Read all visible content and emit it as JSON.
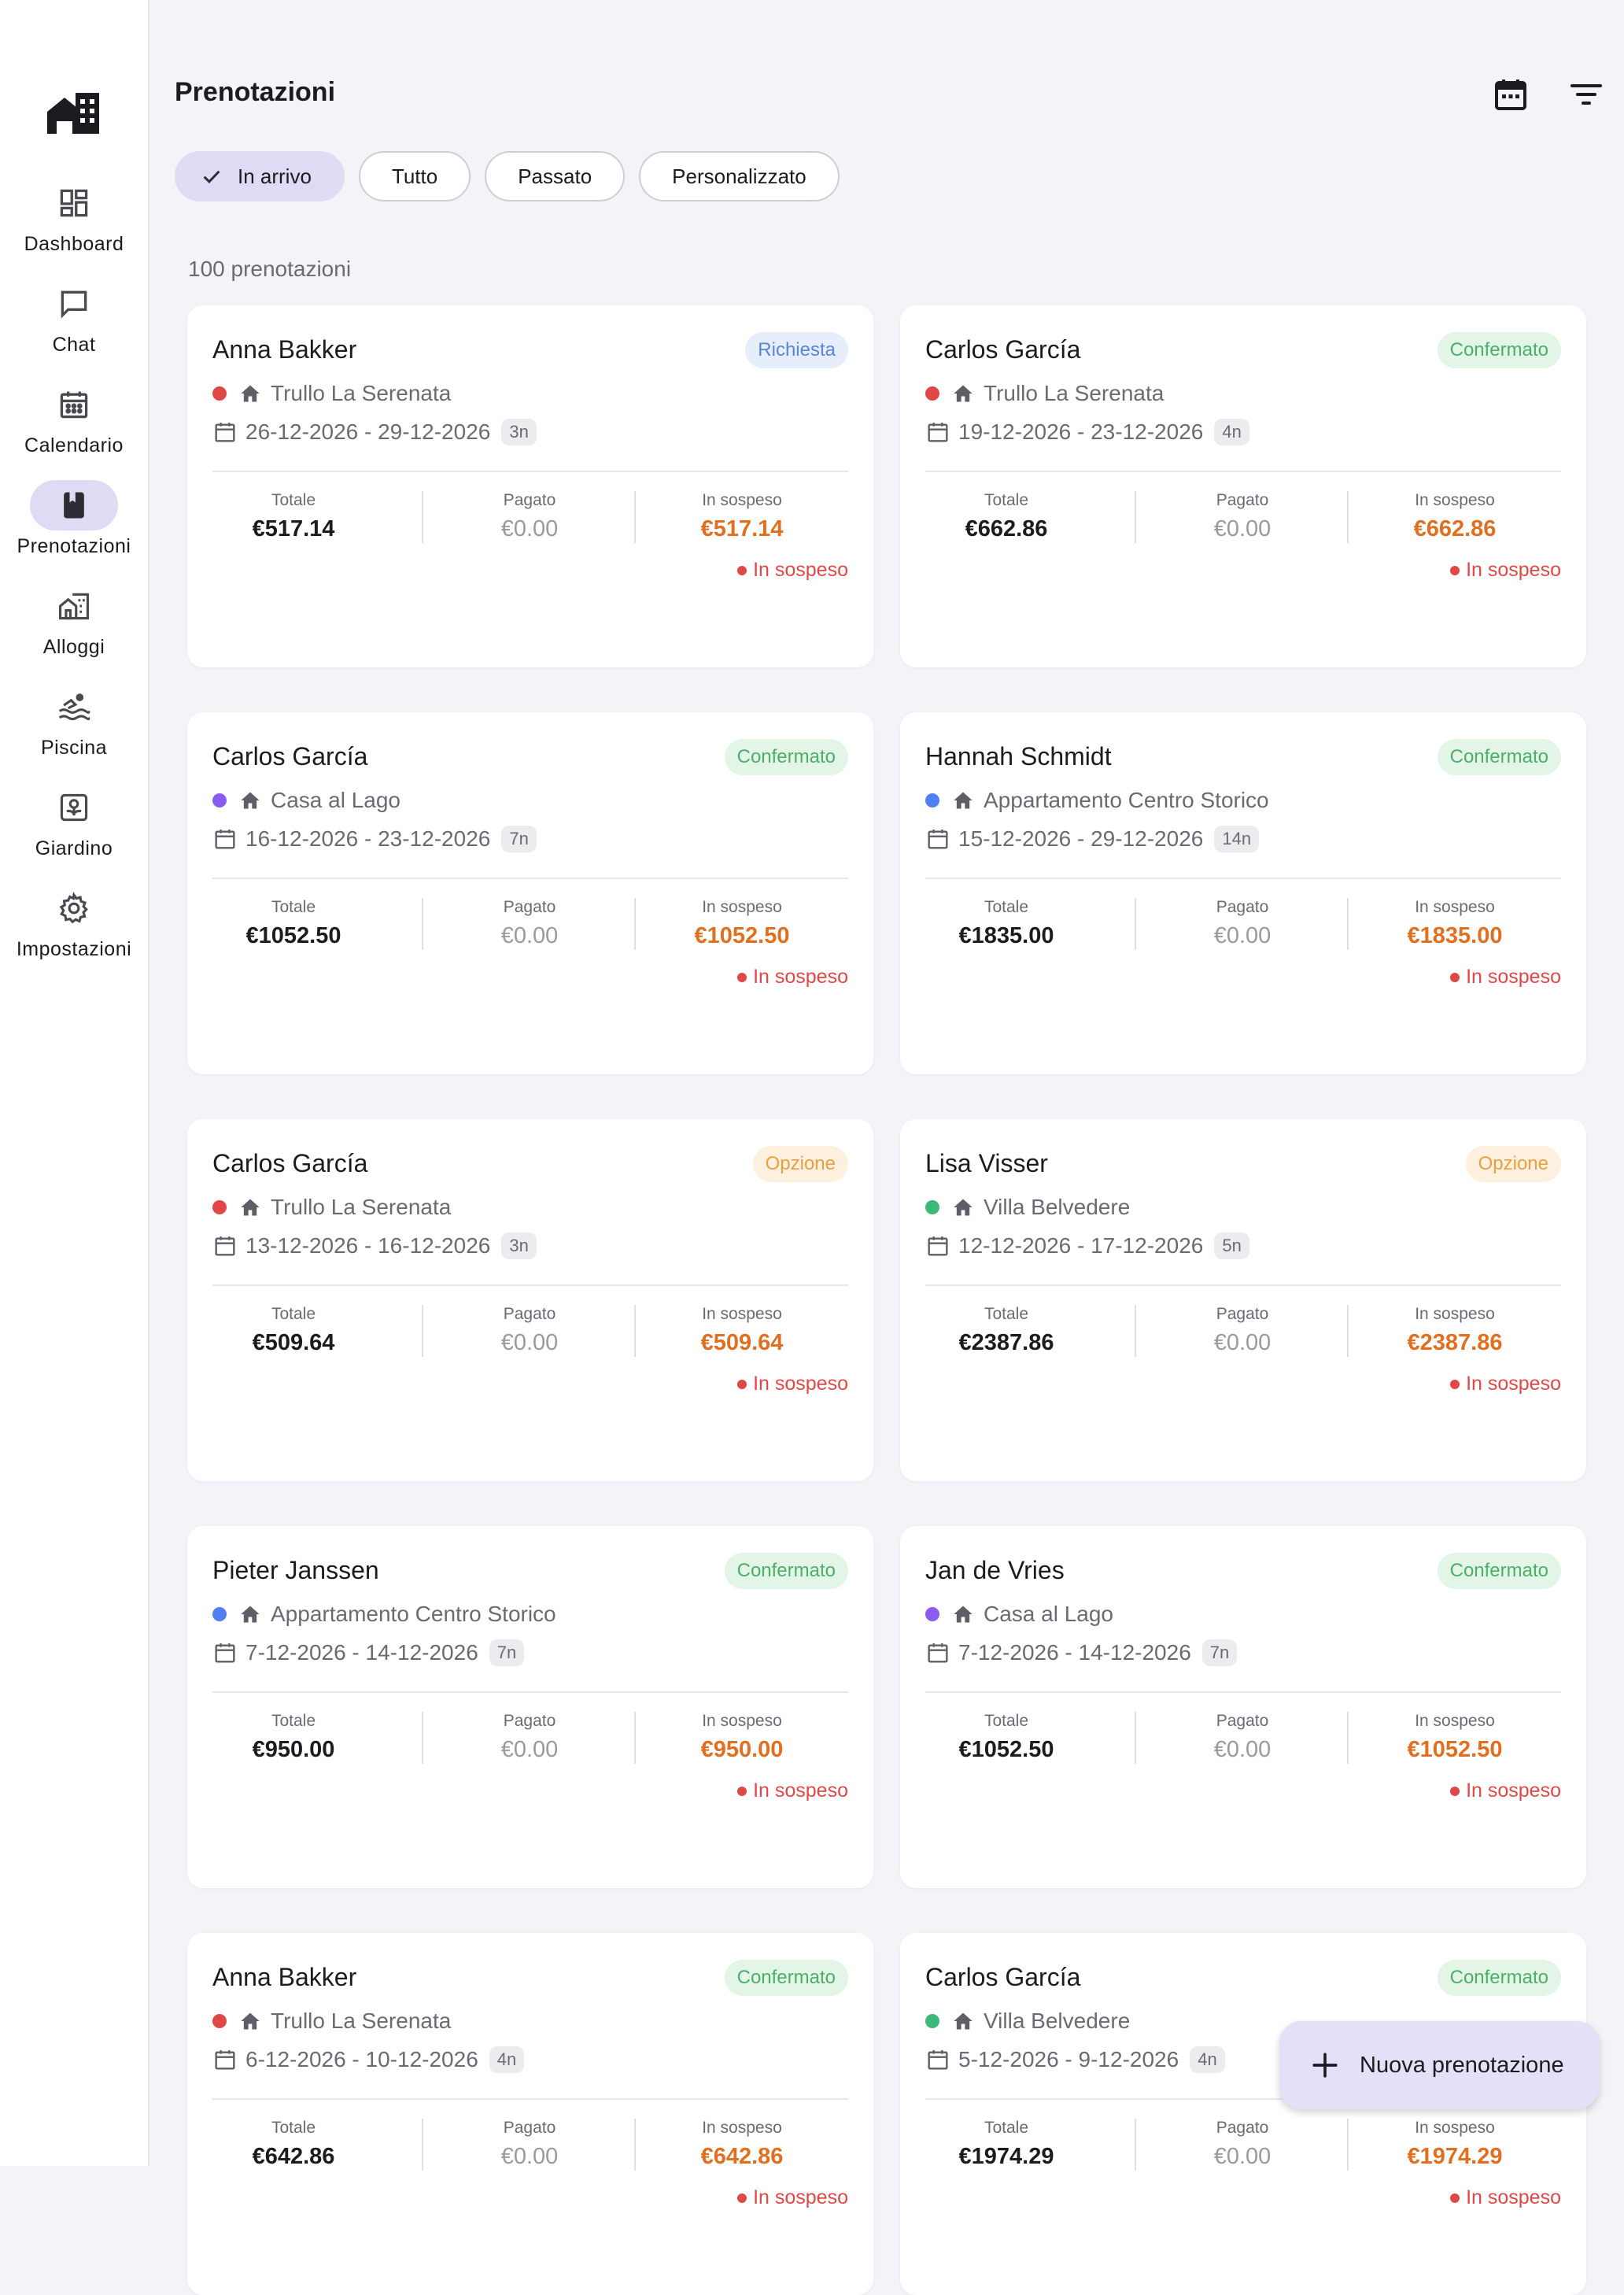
{
  "nav": {
    "items": [
      {
        "label": "Dashboard",
        "icon": "dashboard-icon"
      },
      {
        "label": "Chat",
        "icon": "chat-icon"
      },
      {
        "label": "Calendario",
        "icon": "calendar-icon"
      },
      {
        "label": "Prenotazioni",
        "icon": "bookmark-icon"
      },
      {
        "label": "Alloggi",
        "icon": "building-icon"
      },
      {
        "label": "Piscina",
        "icon": "pool-icon"
      },
      {
        "label": "Giardino",
        "icon": "garden-icon"
      },
      {
        "label": "Impostazioni",
        "icon": "gear-icon"
      }
    ],
    "active": "Prenotazioni"
  },
  "header": {
    "title": "Prenotazioni"
  },
  "filters": {
    "chips": [
      {
        "label": "In arrivo",
        "selected": true
      },
      {
        "label": "Tutto",
        "selected": false
      },
      {
        "label": "Passato",
        "selected": false
      },
      {
        "label": "Personalizzato",
        "selected": false
      }
    ]
  },
  "count_text": "100 prenotazioni",
  "labels": {
    "total": "Totale",
    "paid": "Pagato",
    "pending": "In sospeso",
    "payment_status": "In sospeso"
  },
  "colors": {
    "accent": "#dedbf5",
    "pending_amount": "#e07020",
    "pending_status": "#e04848",
    "properties": {
      "Trullo La Serenata": "#e04848",
      "Casa al Lago": "#8a5cf0",
      "Appartamento Centro Storico": "#4f7ff0",
      "Villa Belvedere": "#3cb878"
    }
  },
  "bookings": [
    {
      "guest": "Anna Bakker",
      "status": "Richiesta",
      "property": "Trullo La Serenata",
      "dates": "26-12-2026 - 29-12-2026",
      "nights": "3n",
      "total": "€517.14",
      "paid": "€0.00",
      "pending": "€517.14"
    },
    {
      "guest": "Carlos García",
      "status": "Confermato",
      "property": "Trullo La Serenata",
      "dates": "19-12-2026 - 23-12-2026",
      "nights": "4n",
      "total": "€662.86",
      "paid": "€0.00",
      "pending": "€662.86"
    },
    {
      "guest": "Carlos García",
      "status": "Confermato",
      "property": "Casa al Lago",
      "dates": "16-12-2026 - 23-12-2026",
      "nights": "7n",
      "total": "€1052.50",
      "paid": "€0.00",
      "pending": "€1052.50"
    },
    {
      "guest": "Hannah Schmidt",
      "status": "Confermato",
      "property": "Appartamento Centro Storico",
      "dates": "15-12-2026 - 29-12-2026",
      "nights": "14n",
      "total": "€1835.00",
      "paid": "€0.00",
      "pending": "€1835.00"
    },
    {
      "guest": "Carlos García",
      "status": "Opzione",
      "property": "Trullo La Serenata",
      "dates": "13-12-2026 - 16-12-2026",
      "nights": "3n",
      "total": "€509.64",
      "paid": "€0.00",
      "pending": "€509.64"
    },
    {
      "guest": "Lisa Visser",
      "status": "Opzione",
      "property": "Villa Belvedere",
      "dates": "12-12-2026 - 17-12-2026",
      "nights": "5n",
      "total": "€2387.86",
      "paid": "€0.00",
      "pending": "€2387.86"
    },
    {
      "guest": "Pieter Janssen",
      "status": "Confermato",
      "property": "Appartamento Centro Storico",
      "dates": "7-12-2026 - 14-12-2026",
      "nights": "7n",
      "total": "€950.00",
      "paid": "€0.00",
      "pending": "€950.00"
    },
    {
      "guest": "Jan de Vries",
      "status": "Confermato",
      "property": "Casa al Lago",
      "dates": "7-12-2026 - 14-12-2026",
      "nights": "7n",
      "total": "€1052.50",
      "paid": "€0.00",
      "pending": "€1052.50"
    },
    {
      "guest": "Anna Bakker",
      "status": "Confermato",
      "property": "Trullo La Serenata",
      "dates": "6-12-2026 - 10-12-2026",
      "nights": "4n",
      "total": "€642.86",
      "paid": "€0.00",
      "pending": "€642.86"
    },
    {
      "guest": "Carlos García",
      "status": "Confermato",
      "property": "Villa Belvedere",
      "dates": "5-12-2026 - 9-12-2026",
      "nights": "4n",
      "total": "€1974.29",
      "paid": "€0.00",
      "pending": "€1974.29"
    }
  ],
  "fab": {
    "label": "Nuova prenotazione"
  }
}
